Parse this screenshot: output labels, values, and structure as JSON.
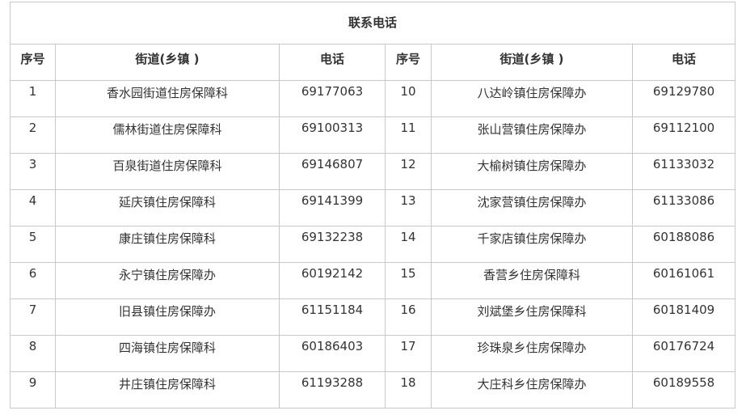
{
  "table": {
    "title": "联系电话",
    "headers": [
      "序号",
      "街道(乡镇 )",
      "电话",
      "序号",
      "街道(乡镇 )",
      "电话"
    ],
    "rows": [
      {
        "no1": "1",
        "name1": "香水园街道住房保障科",
        "tel1": "69177063",
        "no2": "10",
        "name2": "八达岭镇住房保障办",
        "tel2": "69129780"
      },
      {
        "no1": "2",
        "name1": "儒林街道住房保障科",
        "tel1": "69100313",
        "no2": "11",
        "name2": "张山营镇住房保障办",
        "tel2": "69112100"
      },
      {
        "no1": "3",
        "name1": "百泉街道住房保障科",
        "tel1": "69146807",
        "no2": "12",
        "name2": "大榆树镇住房保障办",
        "tel2": "61133032"
      },
      {
        "no1": "4",
        "name1": "延庆镇住房保障科",
        "tel1": "69141399",
        "no2": "13",
        "name2": "沈家营镇住房保障办",
        "tel2": "61133086"
      },
      {
        "no1": "5",
        "name1": "康庄镇住房保障科",
        "tel1": "69132238",
        "no2": "14",
        "name2": "千家店镇住房保障办",
        "tel2": "60188086"
      },
      {
        "no1": "6",
        "name1": "永宁镇住房保障办",
        "tel1": "60192142",
        "no2": "15",
        "name2": "香营乡住房保障科",
        "tel2": "60161061"
      },
      {
        "no1": "7",
        "name1": "旧县镇住房保障办",
        "tel1": "61151184",
        "no2": "16",
        "name2": "刘斌堡乡住房保障科",
        "tel2": "60181409"
      },
      {
        "no1": "8",
        "name1": "四海镇住房保障科",
        "tel1": "60186403",
        "no2": "17",
        "name2": "珍珠泉乡住房保障办",
        "tel2": "60176724"
      },
      {
        "no1": "9",
        "name1": "井庄镇住房保障科",
        "tel1": "61193288",
        "no2": "18",
        "name2": "大庄科乡住房保障办",
        "tel2": "60189558"
      }
    ]
  }
}
